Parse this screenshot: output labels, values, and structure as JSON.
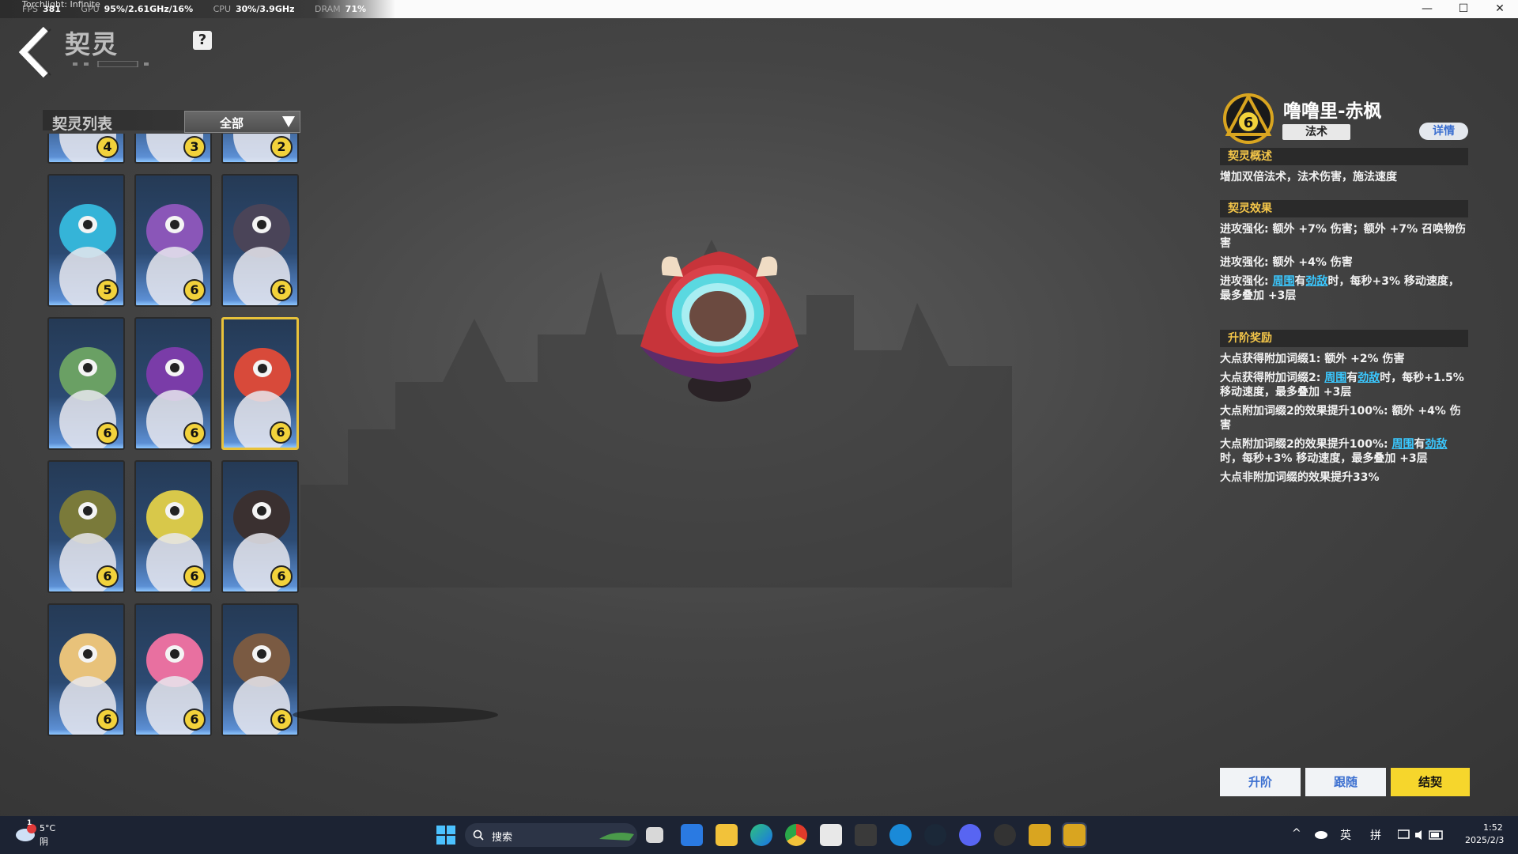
{
  "titlebar": {
    "app_title": "Torchlight: Infinite",
    "stats": [
      {
        "label": "FPS",
        "value": "381"
      },
      {
        "label": "GPU",
        "value": "95%/2.61GHz/16%"
      },
      {
        "label": "CPU",
        "value": "30%/3.9GHz"
      },
      {
        "label": "DRAM",
        "value": "71%"
      }
    ],
    "minimize": "—",
    "maximize": "☐",
    "close": "✕"
  },
  "header": {
    "title": "契灵",
    "help": "?"
  },
  "list": {
    "title": "契灵列表",
    "filter_value": "全部",
    "cards": [
      {
        "level": "4",
        "color": "#e8b64a"
      },
      {
        "level": "3",
        "color": "#c8d6e8"
      },
      {
        "level": "2",
        "color": "#d96a5a"
      },
      {
        "level": "5",
        "color": "#35b4d8"
      },
      {
        "level": "6",
        "color": "#8a56b8"
      },
      {
        "level": "6",
        "color": "#4a4458"
      },
      {
        "level": "6",
        "color": "#6aa064"
      },
      {
        "level": "6",
        "color": "#7a3ca8"
      },
      {
        "level": "6",
        "color": "#d84a3a",
        "selected": true
      },
      {
        "level": "6",
        "color": "#7a7a3a"
      },
      {
        "level": "6",
        "color": "#d8c84a"
      },
      {
        "level": "6",
        "color": "#3a3030"
      },
      {
        "level": "6",
        "color": "#e8c27a"
      },
      {
        "level": "6",
        "color": "#e870a0"
      },
      {
        "level": "6",
        "color": "#7a5a42"
      }
    ]
  },
  "pet": {
    "level": "6",
    "name": "噜噜里-赤枫",
    "type": "法术",
    "details_label": "详情",
    "overview_title": "契灵概述",
    "overview_text": "增加双倍法术，法术伤害，施法速度",
    "effects_title": "契灵效果",
    "effects": {
      "e1": "进攻强化: 额外 +7% 伤害；额外 +7% 召唤物伤害",
      "e2": "进攻强化: 额外 +4% 伤害",
      "e3_a": "进攻强化: ",
      "e3_h1": "周围",
      "e3_b": "有",
      "e3_h2": "劲敌",
      "e3_c": "时，每秒+3% 移动速度，最多叠加 +3层"
    },
    "rewards_title": "升阶奖励",
    "rewards": {
      "r1": "大点获得附加词缀1: 额外 +2% 伤害",
      "r2_a": "大点获得附加词缀2: ",
      "r2_h1": "周围",
      "r2_b": "有",
      "r2_h2": "劲敌",
      "r2_c": "时，每秒+1.5% 移动速度，最多叠加 +3层",
      "r3": "大点附加词缀2的效果提升100%: 额外 +4% 伤害",
      "r4_a": "大点附加词缀2的效果提升100%: ",
      "r4_h1": "周围",
      "r4_b": "有",
      "r4_h2": "劲敌",
      "r4_c": "时，每秒+3% 移动速度，最多叠加 +3层",
      "r5": "大点非附加词缀的效果提升33%"
    }
  },
  "actions": {
    "upgrade": "升阶",
    "follow": "跟随",
    "contract": "结契"
  },
  "taskbar": {
    "weather_temp": "5°C",
    "weather_desc": "阴",
    "weather_badge": "1",
    "search_placeholder": "搜索",
    "lang1": "英",
    "lang2": "拼",
    "time": "1:52",
    "date": "2025/2/3"
  }
}
